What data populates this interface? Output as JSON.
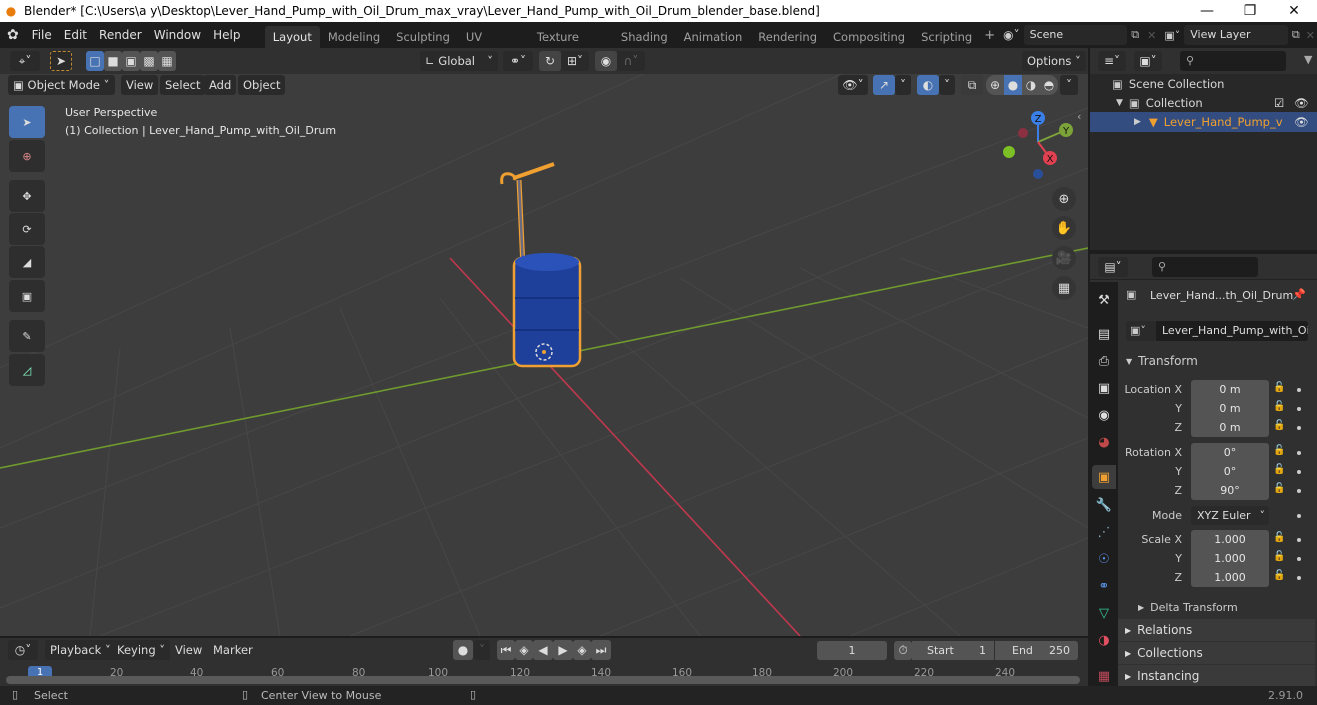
{
  "window": {
    "title": "Blender* [C:\\Users\\a y\\Desktop\\Lever_Hand_Pump_with_Oil_Drum_max_vray\\Lever_Hand_Pump_with_Oil_Drum_blender_base.blend]",
    "minimize": "—",
    "maximize": "❐",
    "close": "✕"
  },
  "menubar": {
    "items": [
      "File",
      "Edit",
      "Render",
      "Window",
      "Help"
    ],
    "workspaces": [
      "Layout",
      "Modeling",
      "Sculpting",
      "UV Editing",
      "Texture Paint",
      "Shading",
      "Animation",
      "Rendering",
      "Compositing",
      "Scripting"
    ],
    "active_workspace": "Layout",
    "add_workspace": "+",
    "scene": "Scene",
    "view_layer": "View Layer"
  },
  "viewport": {
    "transform_orientation": "Global",
    "options_label": "Options",
    "mode": "Object Mode",
    "menus": [
      "View",
      "Select",
      "Add",
      "Object"
    ],
    "overlay_title": "User Perspective",
    "overlay_subtitle": "(1) Collection | Lever_Hand_Pump_with_Oil_Drum",
    "gizmo": {
      "x": "X",
      "y": "Y",
      "z": "Z"
    },
    "colors": {
      "x_axis": "#c0384e",
      "y_axis": "#6f9a2e",
      "drum": "#1e3f9a",
      "selection": "#f0a030",
      "accent": "#4772b3"
    }
  },
  "outliner": {
    "scene_collection": "Scene Collection",
    "collection": "Collection",
    "object": "Lever_Hand_Pump_v"
  },
  "properties": {
    "object_name": "Lever_Hand...th_Oil_Drum",
    "data_name": "Lever_Hand_Pump_with_Oil...",
    "transform_label": "Transform",
    "location_label": "Location X",
    "rotation_label": "Rotation X",
    "scale_label": "Scale X",
    "y_label": "Y",
    "z_label": "Z",
    "location": [
      "0 m",
      "0 m",
      "0 m"
    ],
    "rotation": [
      "0°",
      "0°",
      "90°"
    ],
    "mode_label": "Mode",
    "rotation_mode": "XYZ Euler",
    "scale": [
      "1.000",
      "1.000",
      "1.000"
    ],
    "delta_transform": "Delta Transform",
    "relations": "Relations",
    "collections": "Collections",
    "instancing": "Instancing"
  },
  "timeline": {
    "menus": [
      "Playback",
      "Keying",
      "View",
      "Marker"
    ],
    "current_frame": "1",
    "start_label": "Start",
    "start": "1",
    "end_label": "End",
    "end": "250",
    "ruler": [
      "1",
      "20",
      "40",
      "60",
      "80",
      "100",
      "120",
      "140",
      "160",
      "180",
      "200",
      "220",
      "240"
    ]
  },
  "statusbar": {
    "left": "Select",
    "middle": "Center View to Mouse",
    "version": "2.91.0"
  }
}
